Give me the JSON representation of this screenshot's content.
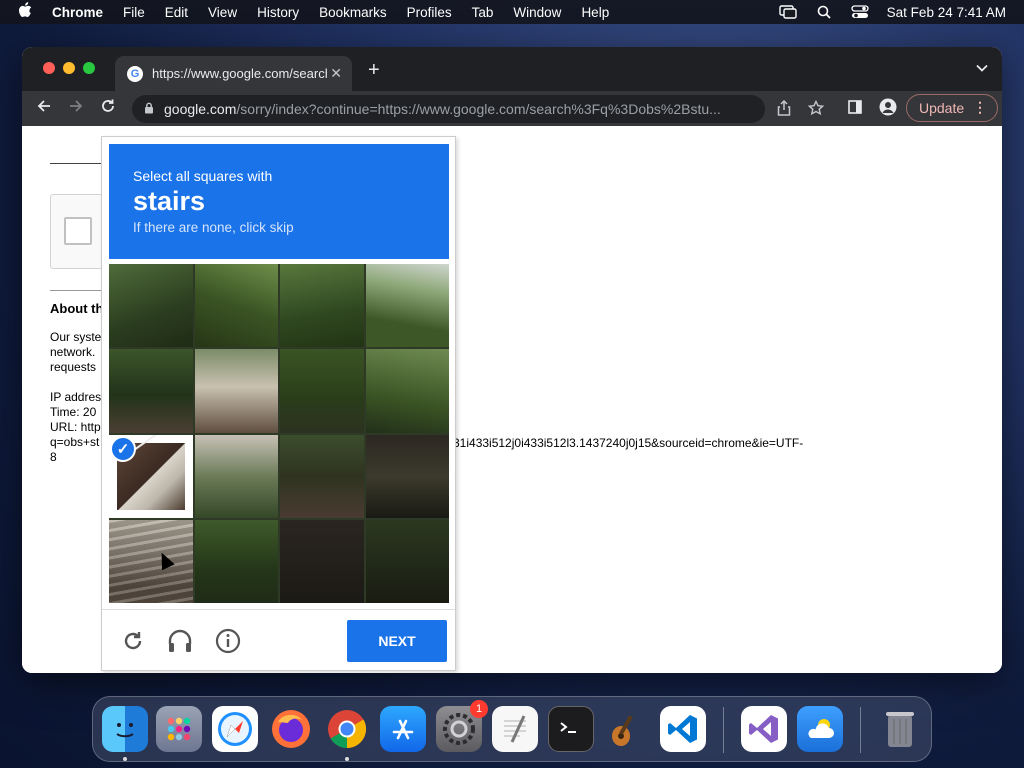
{
  "menubar": {
    "apple": "",
    "app_name": "Chrome",
    "items": [
      "File",
      "Edit",
      "View",
      "History",
      "Bookmarks",
      "Profiles",
      "Tab",
      "Window",
      "Help"
    ],
    "datetime": "Sat Feb 24  7:41 AM"
  },
  "browser": {
    "tab_title": "https://www.google.com/search?q=obs+stu",
    "url_domain": "google.com",
    "url_path": "/sorry/index?continue=https://www.google.com/search%3Fq%3Dobs%2Bstu...",
    "update_label": "Update"
  },
  "page": {
    "about_title": "About th",
    "para1": [
      "Our syste",
      "network.",
      "requests"
    ],
    "ip_lines": [
      "IP addres",
      "Time: 20",
      "URL: http",
      "q=obs+st",
      "8"
    ],
    "url_tail": "31i433i512j0i433i512l3.1437240j0j15&sourceid=chrome&ie=UTF-"
  },
  "captcha": {
    "instruction": "Select all squares with",
    "keyword": "stairs",
    "subtext": "If there are none, click skip",
    "selected_tiles": [
      8
    ],
    "next_label": "NEXT"
  },
  "dock": {
    "apps": [
      "Finder",
      "Launchpad",
      "Safari",
      "Firefox",
      "Chrome",
      "App Store",
      "System Preferences",
      "TextEdit",
      "Terminal",
      "GarageBand",
      "Visual Studio Code",
      "Visual Studio",
      "Weather",
      "Trash"
    ],
    "system_prefs_badge": "1"
  }
}
